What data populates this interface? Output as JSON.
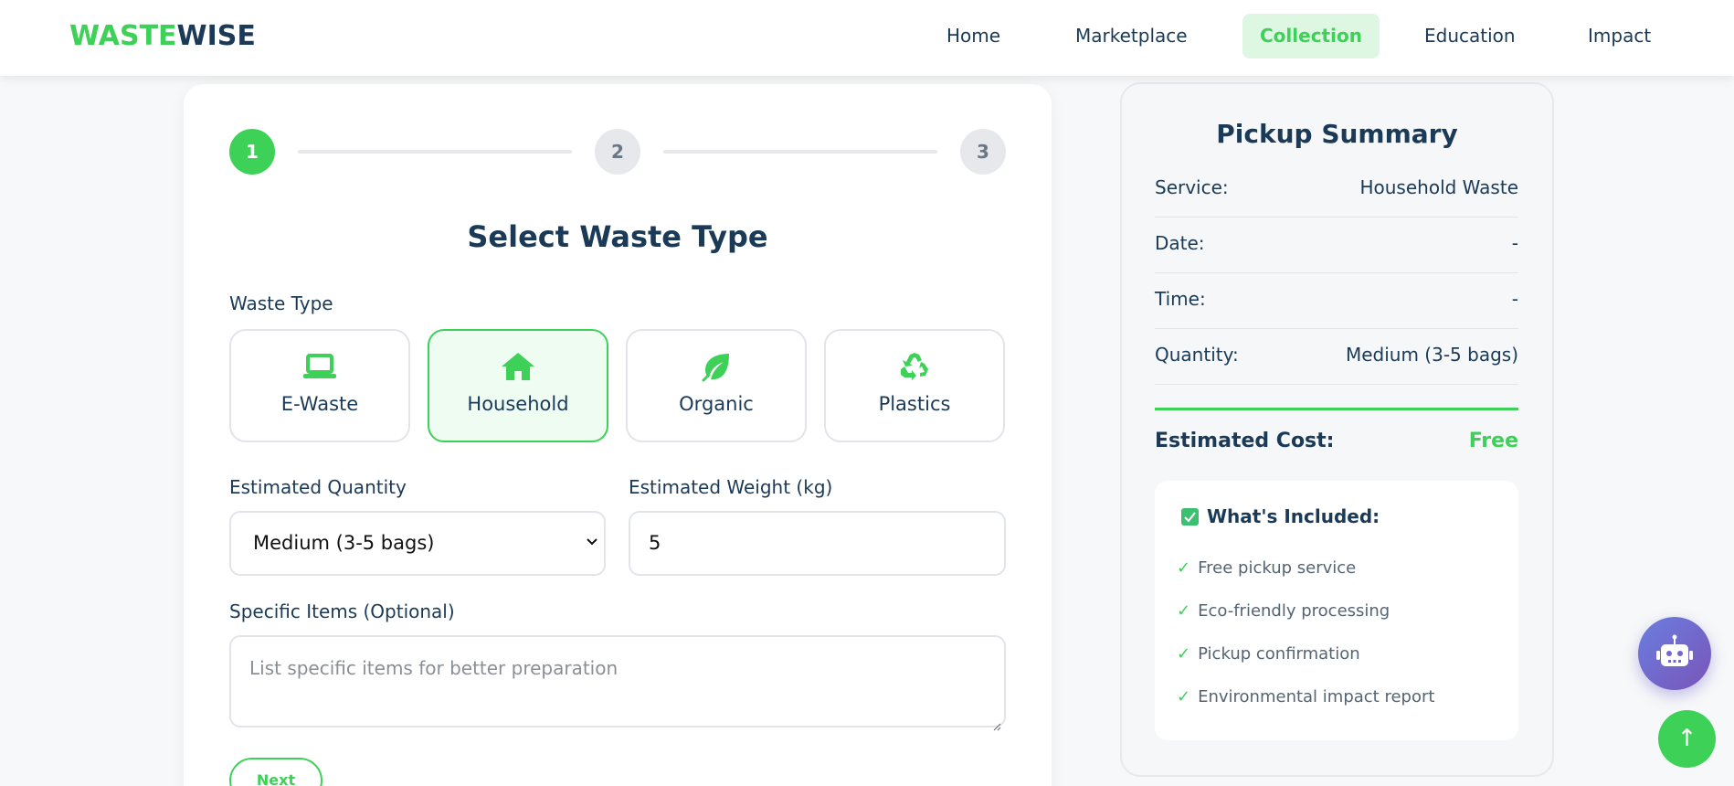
{
  "navbar": {
    "logo_part1": "WASTE",
    "logo_part2": "WISE",
    "items": [
      {
        "label": "Home",
        "active": false
      },
      {
        "label": "Marketplace",
        "active": false
      },
      {
        "label": "Collection",
        "active": true
      },
      {
        "label": "Education",
        "active": false
      },
      {
        "label": "Impact",
        "active": false
      }
    ]
  },
  "stepper": {
    "steps": [
      "1",
      "2",
      "3"
    ],
    "current": 1
  },
  "form": {
    "title": "Select Waste Type",
    "waste_type_label": "Waste Type",
    "types": [
      {
        "label": "E-Waste",
        "icon": "laptop-icon",
        "selected": false
      },
      {
        "label": "Household",
        "icon": "home-icon",
        "selected": true
      },
      {
        "label": "Organic",
        "icon": "leaf-icon",
        "selected": false
      },
      {
        "label": "Plastics",
        "icon": "recycle-icon",
        "selected": false
      }
    ],
    "quantity_label": "Estimated Quantity",
    "quantity_value": "Medium (3-5 bags)",
    "weight_label": "Estimated Weight (kg)",
    "weight_value": "5",
    "items_label": "Specific Items (Optional)",
    "items_placeholder": "List specific items for better preparation",
    "next_label": "Next"
  },
  "summary": {
    "title": "Pickup Summary",
    "rows": [
      {
        "key": "Service:",
        "value": "Household Waste"
      },
      {
        "key": "Date:",
        "value": "-"
      },
      {
        "key": "Time:",
        "value": "-"
      },
      {
        "key": "Quantity:",
        "value": "Medium (3-5 bags)"
      }
    ],
    "cost_label": "Estimated Cost:",
    "cost_value": "Free",
    "included_title": "What's Included:",
    "included_items": [
      "Free pickup service",
      "Eco-friendly processing",
      "Pickup confirmation",
      "Environmental impact report"
    ]
  },
  "floating": {
    "chatbot_icon": "robot-icon",
    "scroll_top_glyph": "↑"
  },
  "colors": {
    "accent": "#3dd158",
    "text": "#1b3a57",
    "chatbot_gradient_start": "#6a7ee0",
    "chatbot_gradient_end": "#7a54b8"
  }
}
